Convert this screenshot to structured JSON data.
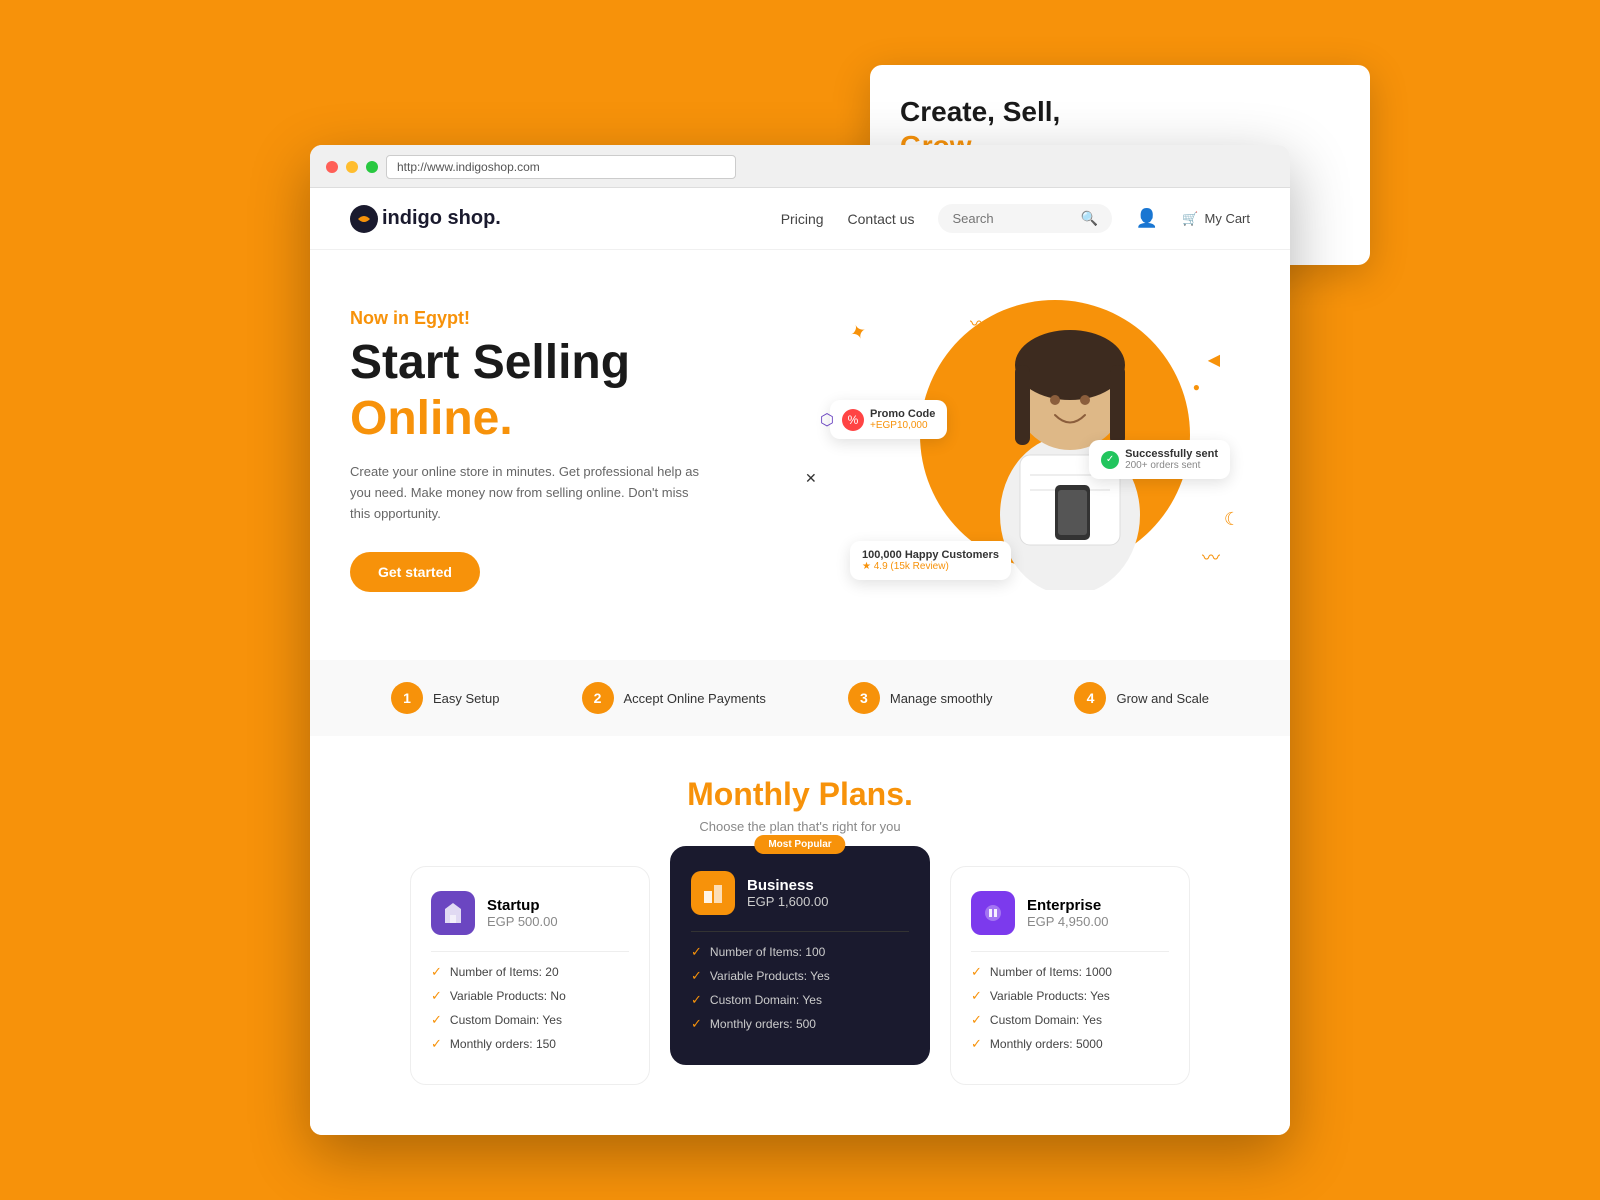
{
  "page": {
    "title": "IndigoShop",
    "url": "http://www.indigoshop.com"
  },
  "nav": {
    "logo": "indigo shop.",
    "links": [
      "Pricing",
      "Contact us"
    ],
    "search_placeholder": "Search",
    "cart_label": "My Cart"
  },
  "hero": {
    "tag": "Now in Egypt!",
    "title_line1": "Start Selling",
    "title_line2": "Online.",
    "description": "Create your online store in minutes. Get professional help as you need. Make money now from selling online. Don't miss this opportunity.",
    "cta": "Get started",
    "promo_label": "Promo Code",
    "promo_value": "+EGP10,000",
    "success_label": "Successfully sent",
    "success_sub": "200+ orders sent",
    "customers_label": "100,000 Happy Customers",
    "customers_rating": "★ 4.9 (15k Review)"
  },
  "features": [
    {
      "num": "1",
      "label": "Easy Setup"
    },
    {
      "num": "2",
      "label": "Accept Online Payments"
    },
    {
      "num": "3",
      "label": "Manage smoothly"
    },
    {
      "num": "4",
      "label": "Grow and Scale"
    }
  ],
  "pricing": {
    "title": "Monthly",
    "title_accent": "Plans.",
    "subtitle": "Choose the plan that's right for you",
    "plans": [
      {
        "id": "startup",
        "name": "Startup",
        "price": "EGP 500.00",
        "featured": false,
        "features": [
          "Number of Items: 20",
          "Variable Products: No",
          "Custom Domain: Yes",
          "Monthly orders: 150"
        ]
      },
      {
        "id": "business",
        "name": "Business",
        "price": "EGP 1,600.00",
        "featured": true,
        "badge": "Most Popular",
        "features": [
          "Number of Items: 100",
          "Variable Products: Yes",
          "Custom Domain: Yes",
          "Monthly orders: 500"
        ]
      },
      {
        "id": "enterprise",
        "name": "Enterprise",
        "price": "EGP 4,950.00",
        "featured": false,
        "features": [
          "Number of Items: 1000",
          "Variable Products: Yes",
          "Custom Domain: Yes",
          "Monthly orders: 5000"
        ]
      }
    ]
  }
}
